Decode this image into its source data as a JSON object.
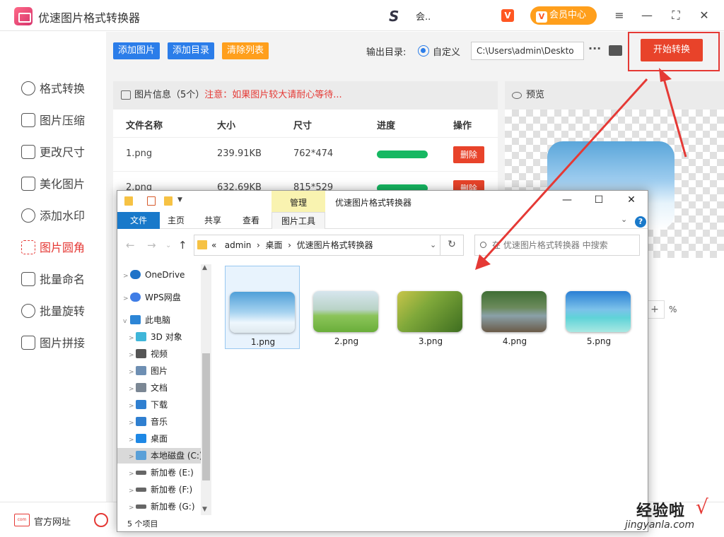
{
  "app": {
    "title": "优速图片格式转换器",
    "user_name": "会..",
    "vip_label": "会员中心",
    "vip_icon_text": "V"
  },
  "window": {
    "menu_icon": "≡",
    "min_icon": "—",
    "max_icon": "⛶",
    "close_icon": "✕"
  },
  "sidebar": {
    "items": [
      {
        "label": "格式转换",
        "icon": "convert-icon"
      },
      {
        "label": "图片压缩",
        "icon": "compress-icon"
      },
      {
        "label": "更改尺寸",
        "icon": "resize-icon"
      },
      {
        "label": "美化图片",
        "icon": "beautify-icon"
      },
      {
        "label": "添加水印",
        "icon": "watermark-icon"
      },
      {
        "label": "图片圆角",
        "icon": "round-corner-icon",
        "active": true
      },
      {
        "label": "批量命名",
        "icon": "rename-icon"
      },
      {
        "label": "批量旋转",
        "icon": "rotate-icon"
      },
      {
        "label": "图片拼接",
        "icon": "stitch-icon"
      }
    ]
  },
  "toolbar": {
    "add_image": "添加图片",
    "add_dir": "添加目录",
    "clear_list": "清除列表",
    "output_label": "输出目录:",
    "custom_label": "自定义",
    "output_path": "C:\\Users\\admin\\Deskto",
    "more": "···",
    "start": "开始转换"
  },
  "info": {
    "title": "图片信息（5个）",
    "warning": "注意：如果图片较大请耐心等待...",
    "columns": [
      "文件名称",
      "大小",
      "尺寸",
      "进度",
      "操作"
    ],
    "rows": [
      {
        "name": "1.png",
        "size": "239.91KB",
        "dims": "762*474",
        "progress": 1.0,
        "action": "删除"
      },
      {
        "name": "2.png",
        "size": "632.69KB",
        "dims": "815*529",
        "progress": 1.0,
        "action": "删除"
      }
    ]
  },
  "preview": {
    "title": "预览",
    "zoom_plus": "+",
    "zoom_unit": "%"
  },
  "footer": {
    "website": "官方网址",
    "com_text": "com"
  },
  "explorer": {
    "manage": "管理",
    "title": "优速图片格式转换器",
    "ribbon": {
      "file": "文件",
      "home": "主页",
      "share": "共享",
      "view": "查看",
      "picture_tools": "图片工具"
    },
    "path": [
      "admin",
      "桌面",
      "优速图片格式转换器"
    ],
    "path_prefix": "«",
    "path_sep": "›",
    "search_placeholder": "在 优速图片格式转换器 中搜索",
    "tree": [
      {
        "label": "OneDrive",
        "color": "#1e73c8"
      },
      {
        "label": "WPS网盘",
        "color": "#3f7de6"
      },
      {
        "label": "此电脑",
        "color": "#2c85d6",
        "expanded": true
      },
      {
        "label": "3D 对象",
        "color": "#3fb6d9"
      },
      {
        "label": "视频",
        "color": "#555555"
      },
      {
        "label": "图片",
        "color": "#6e8fb3"
      },
      {
        "label": "文档",
        "color": "#7b8794"
      },
      {
        "label": "下载",
        "color": "#2f7fd0"
      },
      {
        "label": "音乐",
        "color": "#2f7fd0"
      },
      {
        "label": "桌面",
        "color": "#1e88e5"
      },
      {
        "label": "本地磁盘 (C:)",
        "color": "#5aa0d8",
        "selected": true
      },
      {
        "label": "新加卷 (E:)",
        "color": "#666666"
      },
      {
        "label": "新加卷 (F:)",
        "color": "#666666"
      },
      {
        "label": "新加卷 (G:)",
        "color": "#666666"
      }
    ],
    "files": [
      {
        "label": "1.png",
        "selected": true,
        "gradient": "linear-gradient(180deg,#4f9fd8 0%,#a7d3f0 50%,#eef7fd 75%,#dfe9ef 100%)"
      },
      {
        "label": "2.png",
        "gradient": "linear-gradient(180deg,#d7e6ee 0%,#b9d3c7 45%,#8cc45a 60%,#6aae3a 100%)"
      },
      {
        "label": "3.png",
        "gradient": "linear-gradient(135deg,#c8c54a 0%,#7fa83a 40%,#3e6e20 100%)"
      },
      {
        "label": "4.png",
        "gradient": "linear-gradient(180deg,#3f6e35 0%,#6b8a5b 40%,#8aa0a8 60%,#6a5a48 100%)"
      },
      {
        "label": "5.png",
        "gradient": "linear-gradient(180deg,#2a7fd4 0%,#7cc2ea 45%,#5fd3d8 65%,#a9e8e2 100%)"
      }
    ],
    "status": "5 个项目"
  },
  "watermark": {
    "cn": "经验啦",
    "check": "√",
    "url": "jingyanla.com"
  }
}
